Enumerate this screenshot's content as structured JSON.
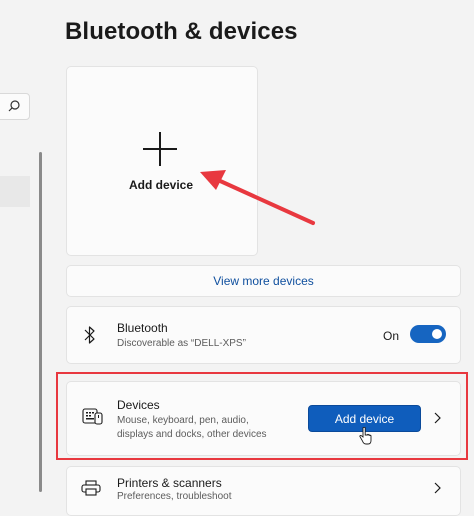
{
  "page_title": "Bluetooth & devices",
  "add_card": {
    "label": "Add device",
    "icon": "plus-icon"
  },
  "view_more": {
    "label": "View more devices"
  },
  "bluetooth": {
    "title": "Bluetooth",
    "subtitle": "Discoverable as “DELL-XPS”",
    "toggle_label": "On",
    "toggle_state": true,
    "icon": "bluetooth-icon"
  },
  "devices": {
    "title": "Devices",
    "subtitle_line1": "Mouse, keyboard, pen, audio,",
    "subtitle_line2": "displays and docks, other devices",
    "button_label": "Add device",
    "icon": "devices-icon"
  },
  "printers": {
    "title": "Printers & scanners",
    "subtitle": "Preferences, troubleshoot",
    "icon": "printer-icon"
  },
  "colors": {
    "accent": "#0f5dbc",
    "link": "#0f4f9e",
    "annotation": "#e8383f"
  }
}
